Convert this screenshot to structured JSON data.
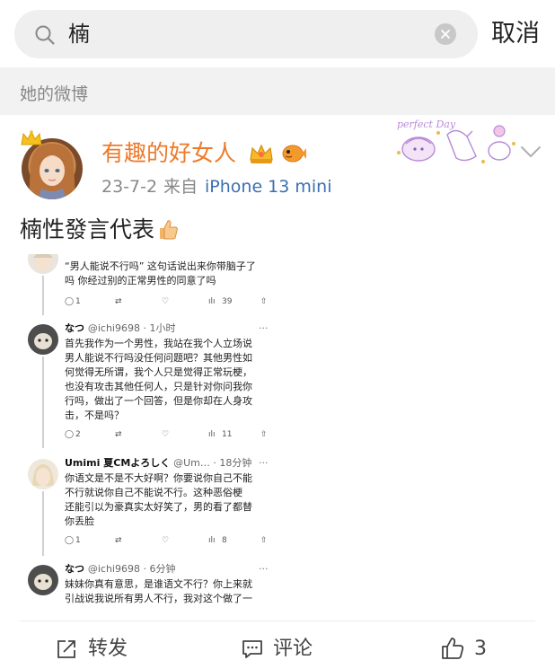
{
  "search": {
    "query": "楠",
    "cancel_label": "取消"
  },
  "section": {
    "title": "她的微博"
  },
  "post": {
    "username": "有趣的好女人",
    "date": "23-7-2",
    "from_label": "来自",
    "device": "iPhone 13 mini",
    "text": "楠性發言代表",
    "accent_color": "#ed7a2a",
    "link_color": "#3b6fb0"
  },
  "embedded": {
    "tweets": [
      {
        "name": "",
        "handle": "",
        "lines": [
          "“男人能说不行吗” 这句话说出来你带脑子了",
          "吗 你经过别的正常男性的同意了吗"
        ],
        "replies": "1",
        "views": "39"
      },
      {
        "name": "なつ",
        "handle": "@ichi9698 · 1小时",
        "lines": [
          "首先我作为一个男性，我站在我个人立场说",
          "男人能说不行吗没任何问题吧？其他男性如",
          "何觉得无所谓，我个人只是觉得正常玩梗，",
          "也没有攻击其他任何人，只是针对你问我你",
          "行吗，做出了一个回答，但是你却在人身攻",
          "击，不是吗？"
        ],
        "replies": "2",
        "views": "11"
      },
      {
        "name": "Umimi",
        "name_extra": "夏CMよろしく",
        "handle": "@Um… · 18分钟",
        "lines": [
          "你语文是不是不大好啊？你要说你自己不能",
          "不行就说你自己不能说不行。这种恶俗梗",
          "还能引以为豪真实太好笑了，男的看了都替",
          "你丢脸"
        ],
        "replies": "1",
        "views": "8"
      },
      {
        "name": "なつ",
        "handle": "@ichi9698 · 6分钟",
        "lines": [
          "妹妹你真有意思，是谁语文不行？你上来就",
          "引战说我说所有男人不行，我对这个做了一"
        ],
        "replies": "",
        "views": ""
      }
    ]
  },
  "footer": {
    "repost_label": "转发",
    "comment_label": "评论",
    "like_count": "3"
  },
  "icons": {
    "search": "search-icon",
    "clear": "clear-icon",
    "chevron": "chevron-down-icon",
    "repost": "repost-icon",
    "comment": "comment-icon",
    "like": "thumbs-up-icon"
  }
}
